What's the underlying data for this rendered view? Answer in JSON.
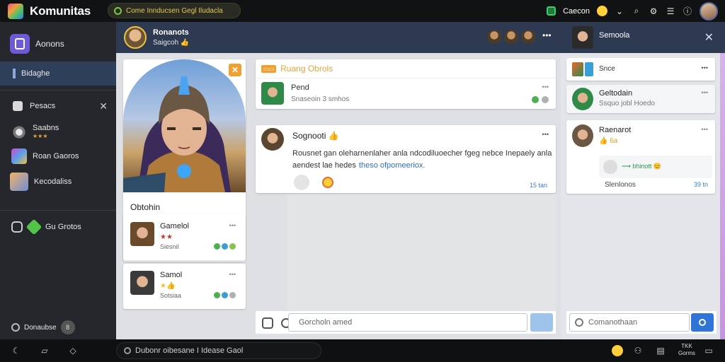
{
  "app": {
    "title": "Komunitas"
  },
  "topbar": {
    "search_text": "Come Innducsen Gegl Iludacla",
    "status_label": "Caecon",
    "icons": [
      "chevron-down-icon",
      "search-icon",
      "gear-icon",
      "list-icon",
      "info-icon"
    ]
  },
  "sidebar": {
    "header": "Aonons",
    "items": [
      {
        "label": "Bidaghe",
        "active": true
      },
      {
        "label": "Pesacs"
      },
      {
        "label": "Saabns",
        "stars": "★★★"
      },
      {
        "label": "Roan Gaoros"
      },
      {
        "label": "Kecodaliss"
      },
      {
        "label": "Gu Grotos"
      }
    ],
    "footer_label": "Donaubse",
    "footer_badge": "8"
  },
  "bottombar": {
    "search_text": "Dubonr oibesane I Idease Gaol",
    "right_label_1": "TKK",
    "right_label_2": "Gorms"
  },
  "main": {
    "header": {
      "name": "Ronanots",
      "sub": "Saigcoh 👍"
    },
    "hero": {
      "close": "✕",
      "title": "Obtohin",
      "chars": [
        {
          "name": "Gamelol",
          "stars": "★★",
          "sub": "Siesnil",
          "dots": "••• ",
          "colors": [
            "#4caf50",
            "#3a9fd6",
            "#8bc34a"
          ]
        },
        {
          "name": "Samol",
          "stars": "★👍",
          "sub": "Sotsiaa",
          "dots": "••• ",
          "colors": [
            "#4caf50",
            "#3a9fd6",
            "#b0b0b0"
          ]
        }
      ]
    },
    "feed_card": {
      "badge": "▭▭",
      "title": "Ruang Obrols",
      "item_name": "Pend",
      "item_sub": "Snaseoin 3 smhos",
      "menu": "•••"
    },
    "post": {
      "author": "Sognooti 👍",
      "menu": "•••",
      "body_1": "Rousnet gan oleharnenlaher anla ndcodiluoecher fgeg nebce Inepaely anla",
      "body_2": "aendest lae hedes",
      "body_link": "theso ofpomeeriox.",
      "count": "15 tan"
    },
    "composer": {
      "placeholder": "Gorcholn amed"
    }
  },
  "rpanel": {
    "header": {
      "name": "Semoola"
    },
    "top_row": {
      "label": "Snce",
      "menu": "•••"
    },
    "items": [
      {
        "name": "Geltodain",
        "sub": "Ssquo jobl Hoedo",
        "menu": "•••"
      },
      {
        "name": "Raenarot",
        "badge": "👍 6a",
        "menu": "•••",
        "reply_text": "⟶ bhinott 😊",
        "footer": "Slenlonos",
        "count": "39 tn"
      }
    ],
    "composer": {
      "placeholder": "Comanothaan"
    }
  }
}
